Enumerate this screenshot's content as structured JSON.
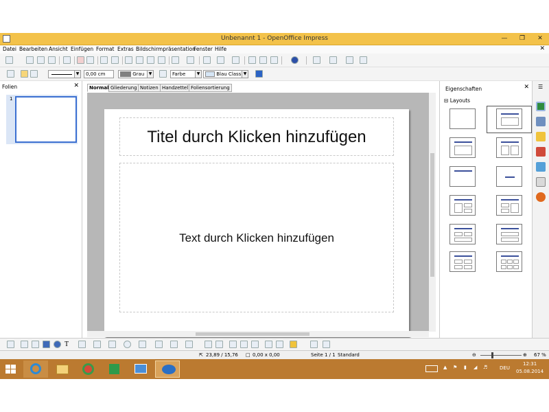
{
  "window": {
    "title": "Unbenannt 1 - OpenOffice Impress"
  },
  "menu": [
    "Datei",
    "Bearbeiten",
    "Ansicht",
    "Einfügen",
    "Format",
    "Extras",
    "Bildschirmpräsentation",
    "Fenster",
    "Hilfe"
  ],
  "format_toolbar": {
    "line_width": "0,00 cm",
    "line_color": "Grau",
    "area_style": "Farbe",
    "area_color": "Blau Classic"
  },
  "slides_pane": {
    "header": "Folien",
    "slide_number": "1"
  },
  "view_tabs": [
    "Normal",
    "Gliederung",
    "Notizen",
    "Handzettel",
    "Foliensortierung"
  ],
  "slide": {
    "title_placeholder": "Titel durch Klicken hinzufügen",
    "body_placeholder": "Text durch Klicken hinzufügen"
  },
  "properties": {
    "header": "Eigenschaften",
    "section": "Layouts"
  },
  "status": {
    "position": "23,89 / 15,76",
    "size": "0,00 x 0,00",
    "page": "Seite 1 / 1",
    "master": "Standard",
    "zoom": "67 %"
  },
  "taskbar": {
    "time": "12:31",
    "date": "05.08.2014",
    "lang": "DEU"
  },
  "colors": {
    "titlebar": "#f3c24a",
    "taskbar": "#bb7a30",
    "selection": "#3b6fd1"
  }
}
